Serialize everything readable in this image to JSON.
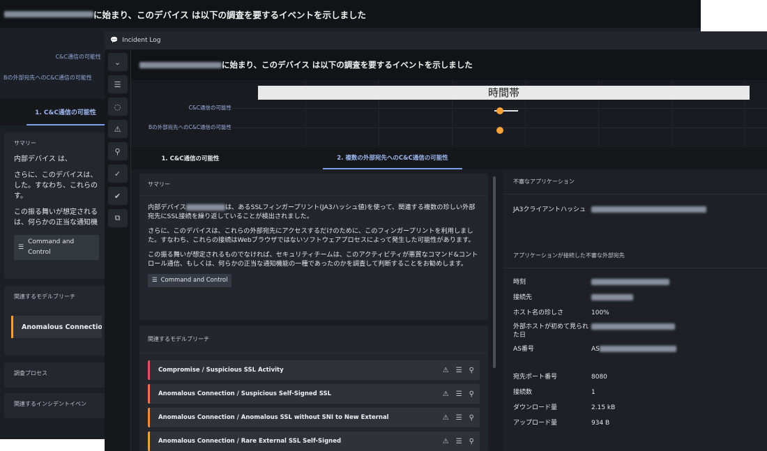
{
  "background_window": {
    "header_text": "に始まり、このデバイス は以下の調査を要するイベントを示しました",
    "chart_rows": [
      "C&C通信の可能性",
      "Bの外部宛先へのC&C通信の可能性"
    ],
    "tab_active": "1. C&C通信の可能性",
    "summary_title": "サマリー",
    "summary_lines": [
      "内部デバイス は、",
      "さらに、このデバイスは、",
      "した。すなわち、これらの",
      "す。",
      "この振る舞いが想定される",
      "は、何らかの正当な通知機"
    ],
    "tag_label": "Command and Control",
    "models_title": "関連するモデルブリーチ",
    "model_item": "Anomalous Connection /",
    "process_title": "調査プロセス",
    "incident_title": "関連するインシデントイベン"
  },
  "window": {
    "title": "Incident Log",
    "header_text": "に始まり、このデバイス は以下の調査を要するイベントを示しました"
  },
  "rail_icons": [
    "chevron-down-icon",
    "list-icon",
    "chat-icon",
    "warning-icon",
    "pin-icon",
    "check-icon",
    "check-double-icon",
    "copy-icon"
  ],
  "chart": {
    "title": "時間帯",
    "rows": [
      "C&C通信の可能性",
      "Bの外部宛先へのC&C通信の可能性"
    ]
  },
  "chart_data": {
    "type": "scatter",
    "title": "時間帯",
    "categories": [
      "C&C通信の可能性",
      "Bの外部宛先へのC&C通信の可能性"
    ],
    "x": [
      0.46,
      0.46
    ],
    "x_range": [
      0.42,
      0.5
    ],
    "grid": true
  },
  "tabs": [
    {
      "label": "1. C&C通信の可能性",
      "active": false
    },
    {
      "label": "2. 複数の外部宛先へのC&C通信の可能性",
      "active": true
    }
  ],
  "summary": {
    "title": "サマリー",
    "p1_prefix": "内部デバイス",
    "p1_suffix": "は、あるSSLフィンガープリント(JA3ハッシュ値)を使って、関連する複数の珍しい外部宛先にSSL接続を繰り返していることが検出されました。",
    "p2": "さらに、このデバイスは、これらの外部宛先にアクセスするだけのために、このフィンガープリントを利用しました。すなわち、これらの接続はWebブラウザではないソフトウェアプロセスによって発生した可能性があります。",
    "p3": "この振る舞いが想定されるものでなければ、セキュリティチームは、このアクティビティが悪質なコマンド&コントロール通信、もしくは、何らかの正当な通知機能の一種であったのかを調査して判断することをお勧めします。",
    "tag": "Command and Control"
  },
  "models": {
    "title": "関連するモデルブリーチ",
    "items": [
      {
        "label": "Compromise / Suspicious SSL Activity",
        "color": "#e0515c"
      },
      {
        "label": "Anomalous Connection / Suspicious Self-Signed SSL",
        "color": "#e8744a"
      },
      {
        "label": "Anomalous Connection / Anomalous SSL without SNI to New External",
        "color": "#ee8a40"
      },
      {
        "label": "Anomalous Connection / Rare External SSL Self-Signed",
        "color": "#f0a13a"
      }
    ]
  },
  "right_panel": {
    "app_title": "不審なアプリケーション",
    "ja3_label": "JA3クライアントハッシュ",
    "dest_title": "アプリケーションが接続した不審な外部宛先",
    "fields": [
      {
        "key": "時刻",
        "value": ""
      },
      {
        "key": "接続先",
        "value": ""
      },
      {
        "key": "ホスト名の珍しさ",
        "value": "100%"
      },
      {
        "key": "外部ホストが初めて見られた日",
        "value": ""
      },
      {
        "key": "AS番号",
        "value": "AS"
      }
    ],
    "fields2": [
      {
        "key": "宛先ポート番号",
        "value": "8080"
      },
      {
        "key": "接続数",
        "value": "1"
      },
      {
        "key": "ダウンロード量",
        "value": "2.15 kB"
      },
      {
        "key": "アップロード量",
        "value": "934 B"
      }
    ]
  },
  "colors": {
    "accent": "#7da1e8",
    "dot": "#f7a23b",
    "bg": "#1b1d22"
  }
}
